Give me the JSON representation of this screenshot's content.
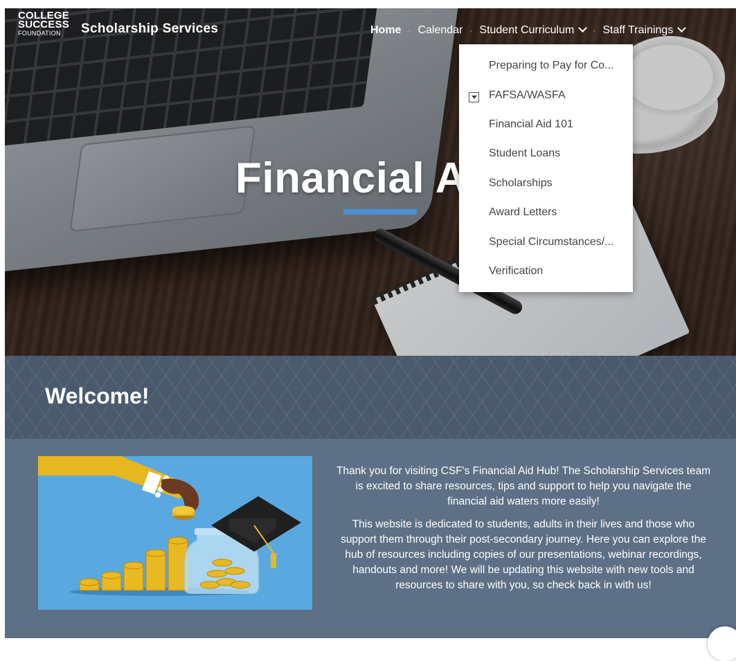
{
  "header": {
    "logo_line1": "COLLEGE",
    "logo_line2": "SUCCESS",
    "logo_line3": "FOUNDATION",
    "site_title": "Scholarship Services"
  },
  "nav": {
    "items": [
      {
        "label": "Home",
        "active": true,
        "has_dropdown": false
      },
      {
        "label": "Calendar",
        "active": false,
        "has_dropdown": false
      },
      {
        "label": "Student Curriculum",
        "active": false,
        "has_dropdown": true
      },
      {
        "label": "Staff Trainings",
        "active": false,
        "has_dropdown": true
      }
    ],
    "separator": "·"
  },
  "dropdown": {
    "items": [
      "Preparing to Pay for Co...",
      "FAFSA/WASFA",
      "Financial Aid 101",
      "Student Loans",
      "Scholarships",
      "Award Letters",
      "Special Circumstances/...",
      "Verification"
    ]
  },
  "hero": {
    "title": "Financial Aid"
  },
  "welcome": {
    "title": "Welcome!"
  },
  "intro": {
    "paragraph1": "Thank you for visiting CSF's Financial Aid Hub! The Scholarship Services team is excited to share resources, tips and support to help you navigate the financial aid waters more easily!",
    "paragraph2": "This website is dedicated to students, adults in their lives and those who support them through their post-secondary  journey. Here you can explore the hub of resources including copies of our presentations, webinar recordings, handouts and more! We will be updating this website with new tools and resources to share with you, so check back in with us!"
  },
  "colors": {
    "accent_bar": "#4b8fcf",
    "welcome_band": "#4a5a6c",
    "content_bg": "#5d7085",
    "illustration_bg": "#5aa8e0"
  }
}
